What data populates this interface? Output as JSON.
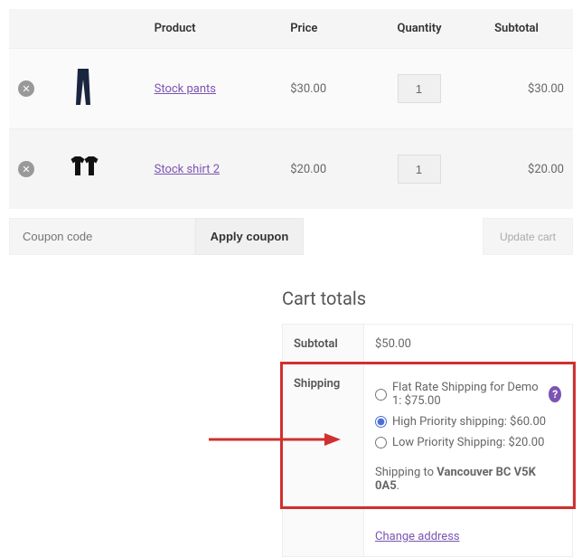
{
  "table": {
    "headers": {
      "product": "Product",
      "price": "Price",
      "quantity": "Quantity",
      "subtotal": "Subtotal"
    },
    "items": [
      {
        "name": "Stock pants",
        "price": "$30.00",
        "qty": "1",
        "subtotal": "$30.00",
        "thumb": "pants"
      },
      {
        "name": "Stock shirt 2",
        "price": "$20.00",
        "qty": "1",
        "subtotal": "$20.00",
        "thumb": "shirts"
      }
    ]
  },
  "coupon": {
    "placeholder": "Coupon code",
    "apply": "Apply coupon",
    "update": "Update cart"
  },
  "totals": {
    "title": "Cart totals",
    "subtotal_label": "Subtotal",
    "subtotal_value": "$50.00",
    "shipping_label": "Shipping",
    "options": [
      {
        "label": "Flat Rate Shipping for Demo 1: $75.00",
        "selected": false,
        "help": true
      },
      {
        "label": "High Priority shipping: $60.00",
        "selected": true,
        "help": false
      },
      {
        "label": "Low Priority Shipping: $20.00",
        "selected": false,
        "help": false
      }
    ],
    "dest_prefix": "Shipping to ",
    "dest_bold": "Vancouver BC V5K 0A5",
    "change": "Change address"
  }
}
